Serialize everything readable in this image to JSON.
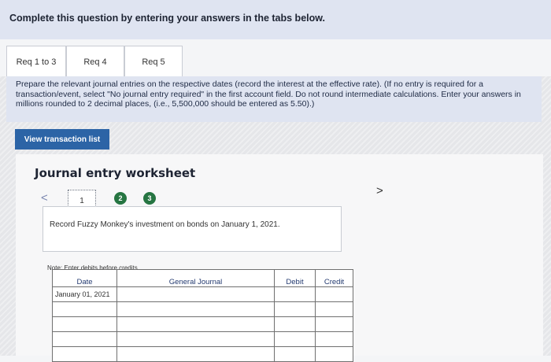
{
  "header": {
    "text": "Complete this question by entering your answers in the tabs below."
  },
  "tabs": [
    {
      "label": "Req 1 to 3"
    },
    {
      "label": "Req 4"
    },
    {
      "label": "Req 5"
    }
  ],
  "instructions": {
    "text": "Prepare the relevant journal entries on the respective dates (record the interest at the effective rate). (If no entry is required for a transaction/event, select \"No journal entry required\" in the first account field. Do not round intermediate calculations. Enter your answers in millions rounded to 2 decimal places, (i.e., 5,500,000 should be entered as 5.50).)"
  },
  "view_button": {
    "label": "View transaction list"
  },
  "worksheet": {
    "title": "Journal entry worksheet",
    "steps": [
      "1",
      "2",
      "3"
    ],
    "nav_prev": "<",
    "nav_next": ">",
    "record_text": "Record Fuzzy Monkey's investment on bonds on January 1, 2021.",
    "note": "Note: Enter debits before credits."
  },
  "table": {
    "headers": {
      "date": "Date",
      "general_journal": "General Journal",
      "debit": "Debit",
      "credit": "Credit"
    },
    "rows": [
      {
        "date": "January 01, 2021"
      },
      {
        "date": ""
      },
      {
        "date": ""
      },
      {
        "date": ""
      },
      {
        "date": ""
      }
    ]
  },
  "colors": {
    "tab_highlight": "#dfe4f1",
    "button": "#2c64a6",
    "step_badge": "#267542"
  }
}
